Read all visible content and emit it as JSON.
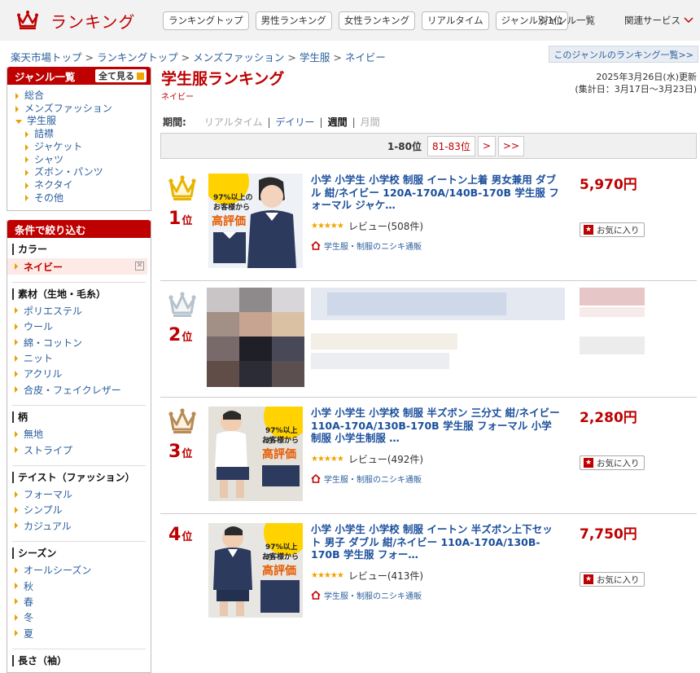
{
  "header": {
    "logo_text": "ランキング",
    "nav": [
      "ランキングトップ",
      "男性ランキング",
      "女性ランキング",
      "リアルタイム",
      "ジャンル別1位"
    ],
    "genre_list": "ジャンル一覧",
    "related": "関連サービス"
  },
  "breadcrumb": [
    "楽天市場トップ",
    "ランキングトップ",
    "メンズファッション",
    "学生服",
    "ネイビー"
  ],
  "genre_ranking_link": "このジャンルのランキング一覧>>",
  "genre_box": {
    "title": "ジャンル一覧",
    "view_all": "全て見る",
    "items": [
      {
        "label": "総合",
        "level": 0
      },
      {
        "label": "メンズファッション",
        "level": 0
      },
      {
        "label": "学生服",
        "level": 0,
        "current": true
      },
      {
        "label": "詰襟",
        "level": 1
      },
      {
        "label": "ジャケット",
        "level": 1
      },
      {
        "label": "シャツ",
        "level": 1
      },
      {
        "label": "ズボン・パンツ",
        "level": 1
      },
      {
        "label": "ネクタイ",
        "level": 1
      },
      {
        "label": "その他",
        "level": 1
      }
    ]
  },
  "filter": {
    "title": "条件で絞り込む",
    "sections": [
      {
        "title": "カラー",
        "items": [
          "ネイビー"
        ],
        "selected": "ネイビー"
      },
      {
        "title": "素材（生地・毛糸）",
        "items": [
          "ポリエステル",
          "ウール",
          "綿・コットン",
          "ニット",
          "アクリル",
          "合皮・フェイクレザー"
        ]
      },
      {
        "title": "柄",
        "items": [
          "無地",
          "ストライプ"
        ]
      },
      {
        "title": "テイスト（ファッション）",
        "items": [
          "フォーマル",
          "シンプル",
          "カジュアル"
        ]
      },
      {
        "title": "シーズン",
        "items": [
          "オールシーズン",
          "秋",
          "春",
          "冬",
          "夏"
        ]
      },
      {
        "title": "長さ（袖）",
        "items": []
      }
    ]
  },
  "main": {
    "title": "学生服ランキング",
    "subtitle": "ネイビー",
    "updated": "2025年3月26日(水)更新",
    "period_range": "(集計日：3月17日〜3月23日)",
    "period_label": "期間:",
    "periods": [
      {
        "label": "リアルタイム",
        "state": "disabled"
      },
      {
        "label": "デイリー",
        "state": "link"
      },
      {
        "label": "週間",
        "state": "current"
      },
      {
        "label": "月間",
        "state": "disabled"
      }
    ],
    "pager": {
      "current": "1-80位",
      "next_range": "81-83位",
      "next": ">",
      "last": ">>"
    }
  },
  "items": [
    {
      "rank": "1",
      "rank_suffix": "位",
      "crown": "gold",
      "name": "小学 小学生 小学校 制服 イートン上着 男女兼用 ダブル 紺/ネイビー 120A-170A/140B-170B 学生服 フォーマル ジャケ…",
      "stars": "★★★★★",
      "review": "レビュー(508件)",
      "shop": "学生服・制服のニシキ通販",
      "price": "5,970円",
      "fav": "お気に入り",
      "badge_lines": [
        "97%以上の",
        "お客様から",
        "高評価"
      ]
    },
    {
      "rank": "2",
      "rank_suffix": "位",
      "crown": "silver",
      "blurred": true
    },
    {
      "rank": "3",
      "rank_suffix": "位",
      "crown": "bronze",
      "name": "小学 小学生 小学校 制服 半ズボン 三分丈 紺/ネイビー 110A-170A/130B-170B 学生服 フォーマル 小学制服 小学生制服 …",
      "stars": "★★★★★",
      "review": "レビュー(492件)",
      "shop": "学生服・制服のニシキ通販",
      "price": "2,280円",
      "fav": "お気に入り",
      "badge_lines": [
        "97%以上の",
        "お客様から",
        "高評価"
      ]
    },
    {
      "rank": "4",
      "rank_suffix": "位",
      "crown": "none",
      "name": "小学 小学生 小学校 制服 イートン 半ズボン上下セット 男子 ダブル 紺/ネイビー 110A-170A/130B-170B 学生服 フォー…",
      "stars": "★★★★★",
      "review": "レビュー(413件)",
      "shop": "学生服・制服のニシキ通販",
      "price": "7,750円",
      "fav": "お気に入り",
      "badge_lines": [
        "97%以上の",
        "お客様から",
        "高評価"
      ]
    }
  ],
  "colors": {
    "brand": "#bf0000",
    "link": "#2a5e9c",
    "gold": "#e8b400",
    "silver": "#b7c2cc",
    "bronze": "#b98a52"
  }
}
